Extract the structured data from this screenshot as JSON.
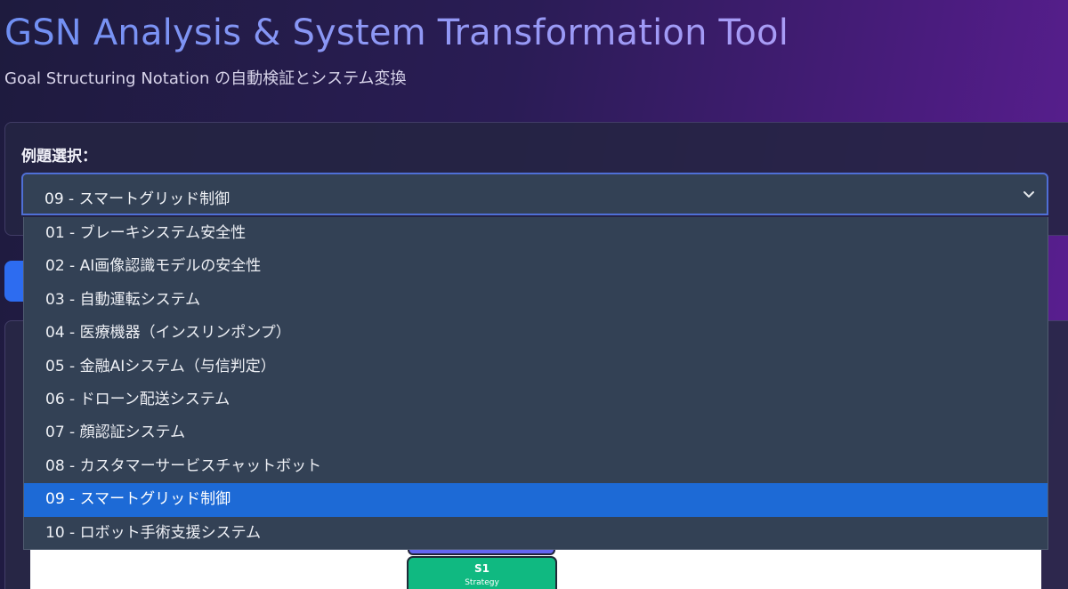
{
  "header": {
    "title": "GSN Analysis & System Transformation Tool",
    "subtitle": "Goal Structuring Notation の自動検証とシステム変換"
  },
  "example_select": {
    "label": "例題選択：",
    "selected_value": "09 - スマートグリッド制御",
    "chevron_icon": "chevron-down-icon",
    "options": [
      "01 - ブレーキシステム安全性",
      "02 - AI画像認識モデルの安全性",
      "03 - 自動運転システム",
      "04 - 医療機器（インスリンポンプ）",
      "05 - 金融AIシステム（与信判定）",
      "06 - ドローン配送システム",
      "07 - 顔認証システム",
      "08 - カスタマーサービスチャットボット",
      "09 - スマートグリッド制御",
      "10 - ロボット手術支援システム"
    ],
    "selected_index": 8
  },
  "diagram": {
    "strategy_node": {
      "id": "S1",
      "type": "Strategy"
    }
  },
  "colors": {
    "accent_blue": "#2d6cf0",
    "selected_option": "#1d6ad6",
    "select_background": "#334155",
    "strategy_node": "#10b981",
    "goal_node": "#6366f1"
  }
}
